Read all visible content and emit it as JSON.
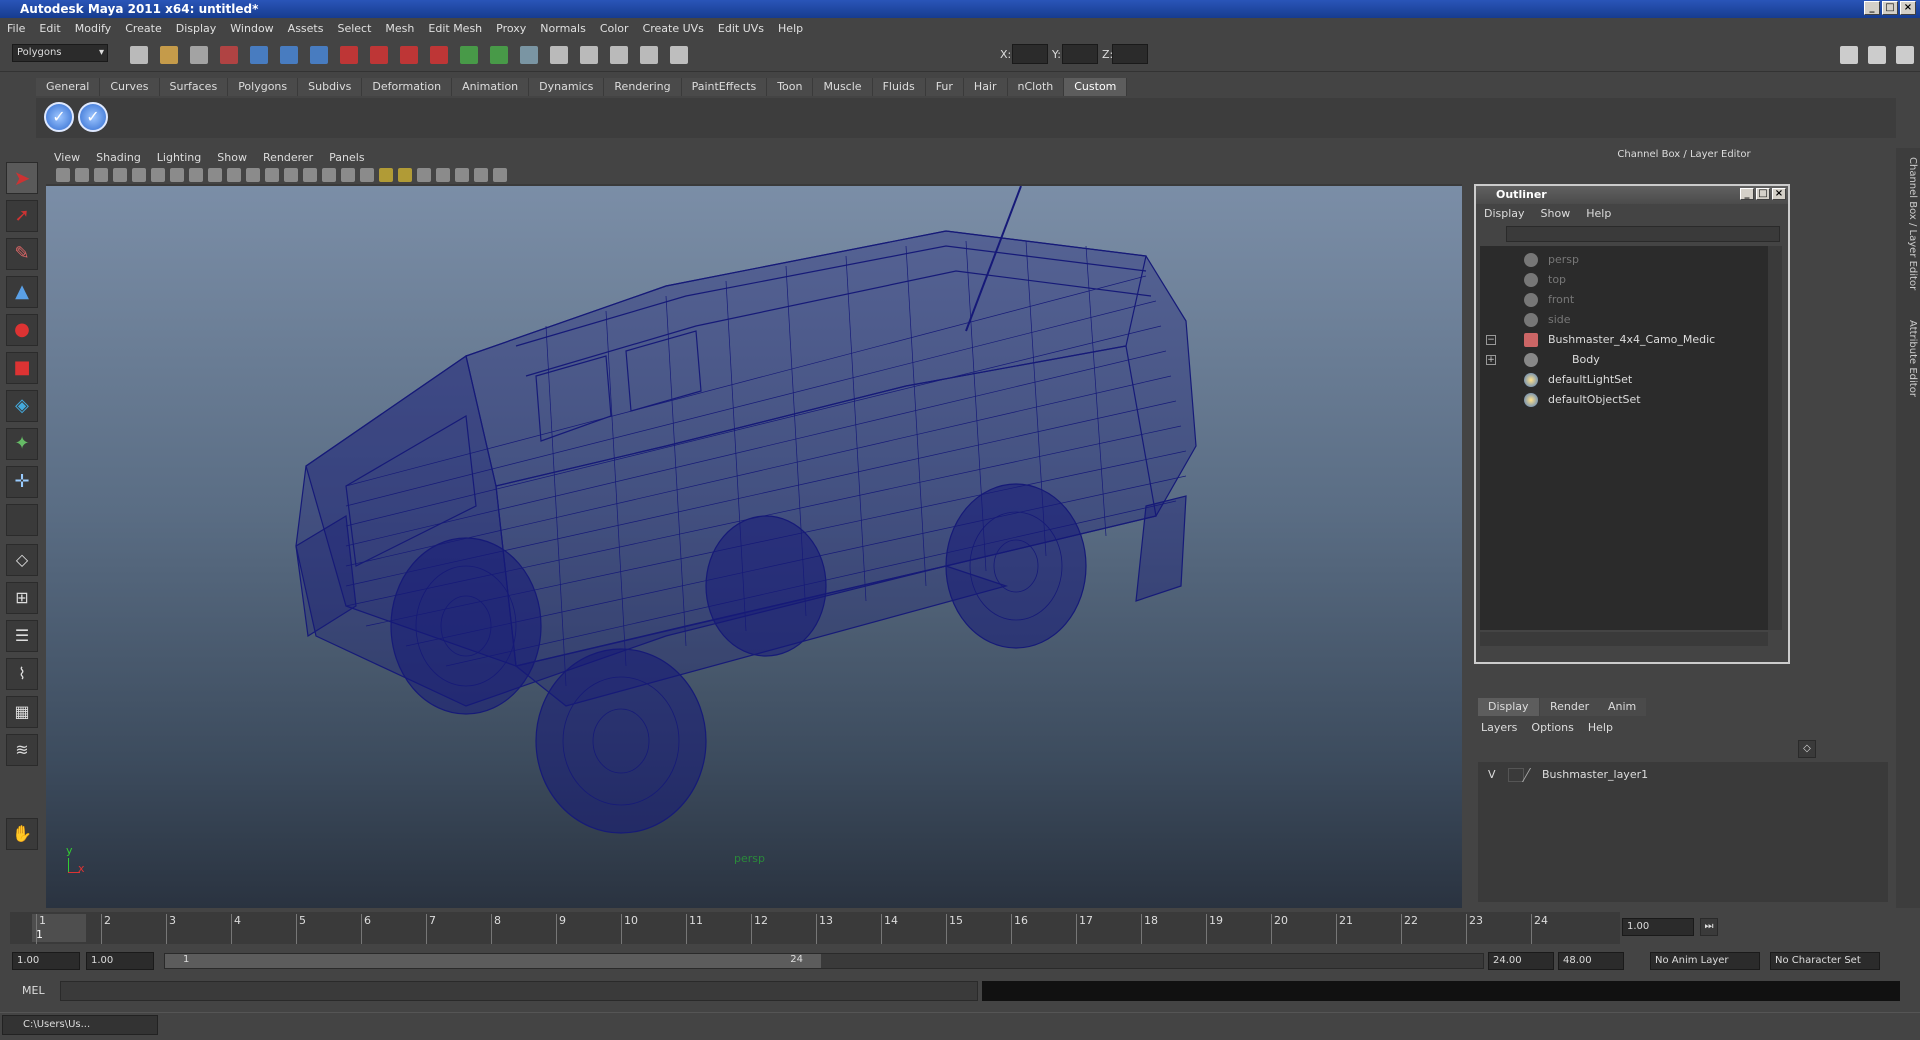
{
  "window": {
    "title": "Autodesk Maya 2011 x64: untitled*"
  },
  "menubar": [
    "File",
    "Edit",
    "Modify",
    "Create",
    "Display",
    "Window",
    "Assets",
    "Select",
    "Mesh",
    "Edit Mesh",
    "Proxy",
    "Normals",
    "Color",
    "Create UVs",
    "Edit UVs",
    "Help"
  ],
  "statusline": {
    "mode": "Polygons",
    "x_label": "X:",
    "y_label": "Y:",
    "z_label": "Z:"
  },
  "shelf_tabs": [
    "General",
    "Curves",
    "Surfaces",
    "Polygons",
    "Subdivs",
    "Deformation",
    "Animation",
    "Dynamics",
    "Rendering",
    "PaintEffects",
    "Toon",
    "Muscle",
    "Fluids",
    "Fur",
    "Hair",
    "nCloth",
    "Custom"
  ],
  "viewport": {
    "menu": [
      "View",
      "Shading",
      "Lighting",
      "Show",
      "Renderer",
      "Panels"
    ],
    "camera_label": "persp",
    "axis_y": "y",
    "axis_x": "x"
  },
  "channel_box_title": "Channel Box / Layer Editor",
  "side_tabs": [
    "Channel Box / Layer Editor",
    "Attribute Editor"
  ],
  "outliner": {
    "title": "Outliner",
    "menu": [
      "Display",
      "Show",
      "Help"
    ],
    "items": [
      {
        "label": "persp",
        "dim": true
      },
      {
        "label": "top",
        "dim": true
      },
      {
        "label": "front",
        "dim": true
      },
      {
        "label": "side",
        "dim": true
      },
      {
        "label": "Bushmaster_4x4_Camo_Medic",
        "dim": false
      },
      {
        "label": "Body",
        "dim": false
      },
      {
        "label": "defaultLightSet",
        "dim": false
      },
      {
        "label": "defaultObjectSet",
        "dim": false
      }
    ]
  },
  "layer_editor": {
    "tabs": [
      "Display",
      "Render",
      "Anim"
    ],
    "menu": [
      "Layers",
      "Options",
      "Help"
    ],
    "layer_visible": "V",
    "layer_name": "Bushmaster_layer1"
  },
  "timeline": {
    "ticks": [
      "1",
      "2",
      "3",
      "4",
      "5",
      "6",
      "7",
      "8",
      "9",
      "10",
      "11",
      "12",
      "13",
      "14",
      "15",
      "16",
      "17",
      "18",
      "19",
      "20",
      "21",
      "22",
      "23",
      "24"
    ],
    "current_frame_marker": "1",
    "current_time": "1.00"
  },
  "range": {
    "start": "1.00",
    "playback_start": "1.00",
    "slider_start": "1",
    "slider_end": "24",
    "playback_end": "24.00",
    "end": "48.00",
    "anim_layer": "No Anim Layer",
    "character_set": "No Character Set"
  },
  "mel": {
    "label": "MEL"
  },
  "taskbar": {
    "item": "C:\\Users\\Us..."
  },
  "colors": {
    "wireframe": "#161a78",
    "accent": "#2a55b8"
  }
}
